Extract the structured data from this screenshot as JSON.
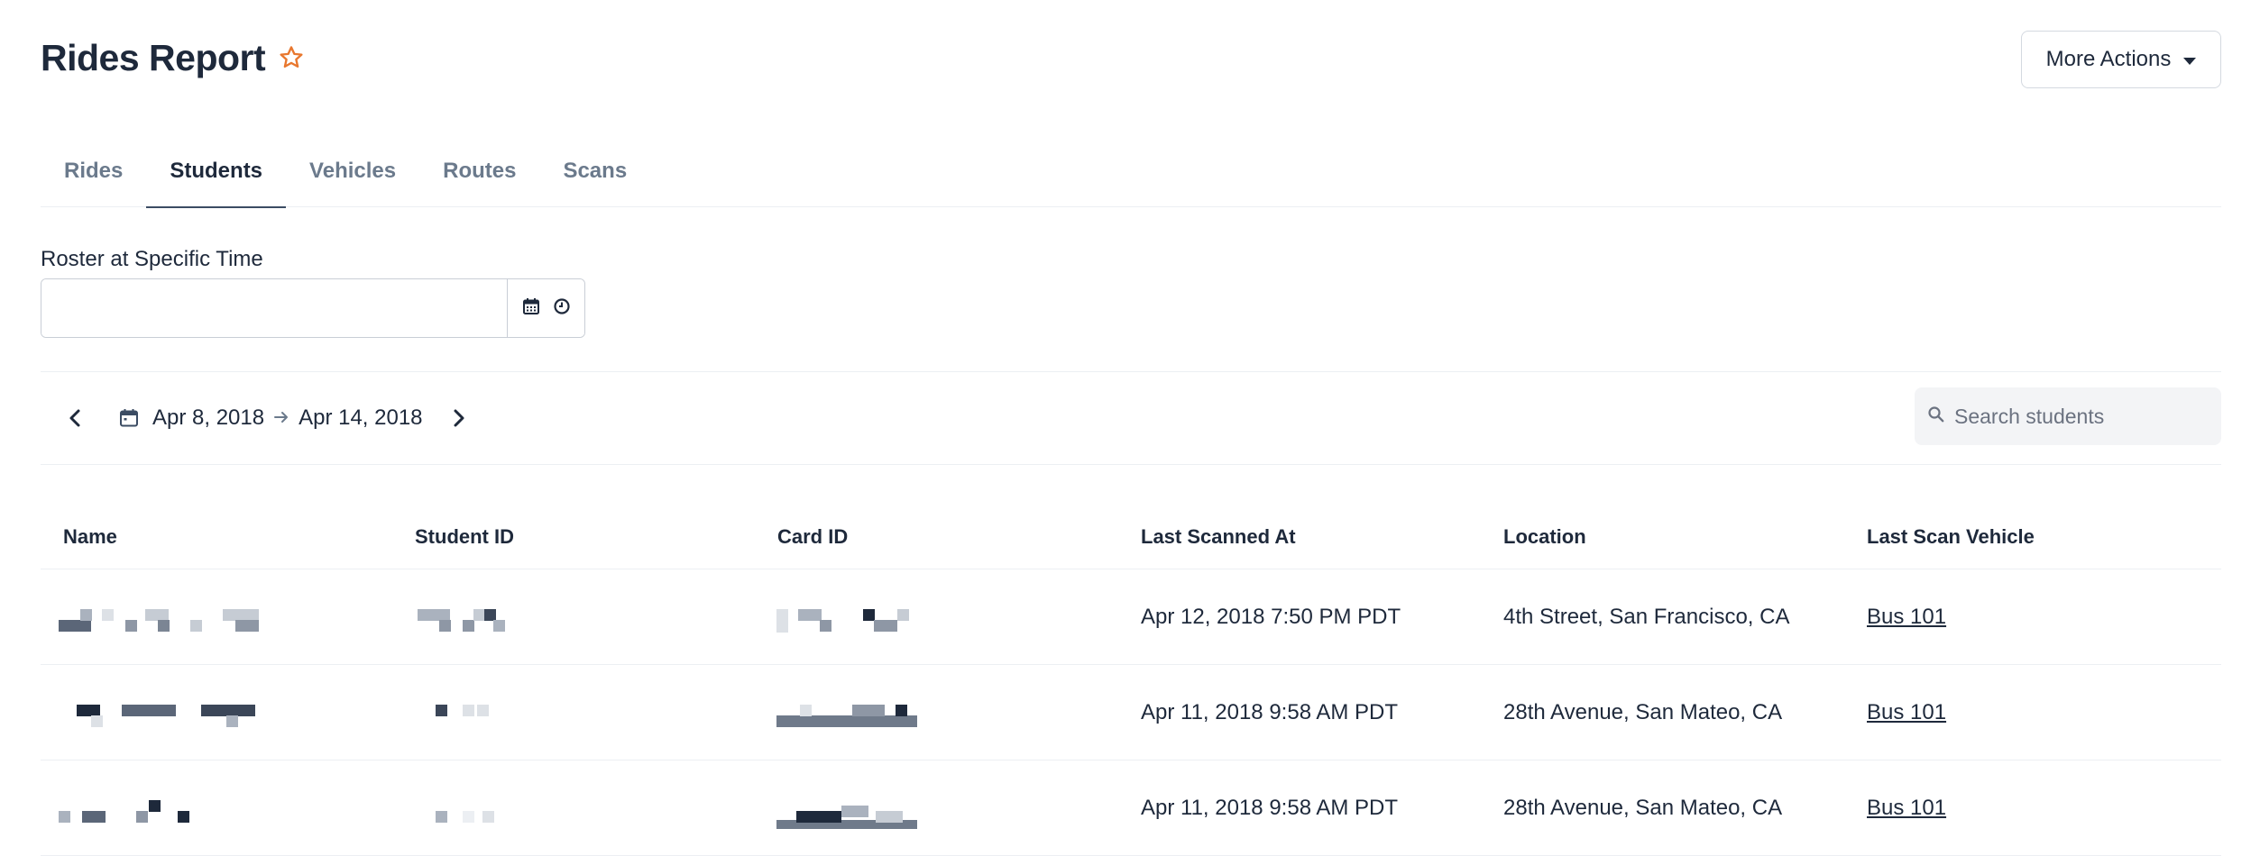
{
  "header": {
    "title": "Rides Report",
    "more_actions_label": "More Actions",
    "star_color": "#e8772e"
  },
  "tabs": [
    {
      "label": "Rides",
      "active": false
    },
    {
      "label": "Students",
      "active": true
    },
    {
      "label": "Vehicles",
      "active": false
    },
    {
      "label": "Routes",
      "active": false
    },
    {
      "label": "Scans",
      "active": false
    }
  ],
  "roster": {
    "label": "Roster at Specific Time",
    "value": ""
  },
  "date_range": {
    "start": "Apr 8, 2018",
    "end": "Apr 14, 2018"
  },
  "search": {
    "placeholder": "Search students",
    "value": ""
  },
  "table": {
    "columns": [
      "Name",
      "Student ID",
      "Card ID",
      "Last Scanned At",
      "Location",
      "Last Scan Vehicle"
    ],
    "rows": [
      {
        "last_scanned_at": "Apr 12, 2018 7:50 PM PDT",
        "location": "4th Street, San Francisco, CA",
        "vehicle": "Bus 101"
      },
      {
        "last_scanned_at": "Apr 11, 2018 9:58 AM PDT",
        "location": "28th Avenue, San Mateo, CA",
        "vehicle": "Bus 101"
      },
      {
        "last_scanned_at": "Apr 11, 2018 9:58 AM PDT",
        "location": "28th Avenue, San Mateo, CA",
        "vehicle": "Bus 101"
      }
    ]
  }
}
